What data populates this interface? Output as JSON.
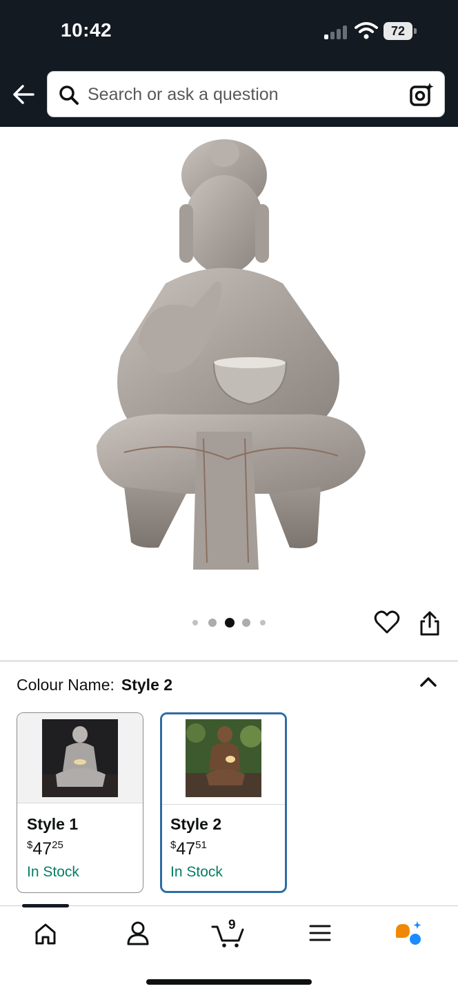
{
  "status_bar": {
    "time": "10:42",
    "battery": "72"
  },
  "search": {
    "placeholder": "Search or ask a question"
  },
  "gallery": {
    "image_count": 5,
    "active_index": 2
  },
  "colour": {
    "label": "Colour Name:",
    "value": "Style 2"
  },
  "styles": [
    {
      "name": "Style 1",
      "currency": "$",
      "price_whole": "47",
      "price_fraction": "25",
      "stock": "In Stock",
      "selected": false
    },
    {
      "name": "Style 2",
      "currency": "$",
      "price_whole": "47",
      "price_fraction": "51",
      "stock": "In Stock",
      "selected": true
    }
  ],
  "bottom_nav": {
    "cart_count": "9",
    "items": [
      "home-icon",
      "account-icon",
      "cart-icon",
      "menu-icon",
      "rufus-icon"
    ]
  },
  "colors": {
    "header_bg": "#131a22",
    "selected_border": "#2e6ca4",
    "in_stock": "#067d62",
    "rufus_orange": "#f08804",
    "rufus_blue": "#1a8cff"
  }
}
